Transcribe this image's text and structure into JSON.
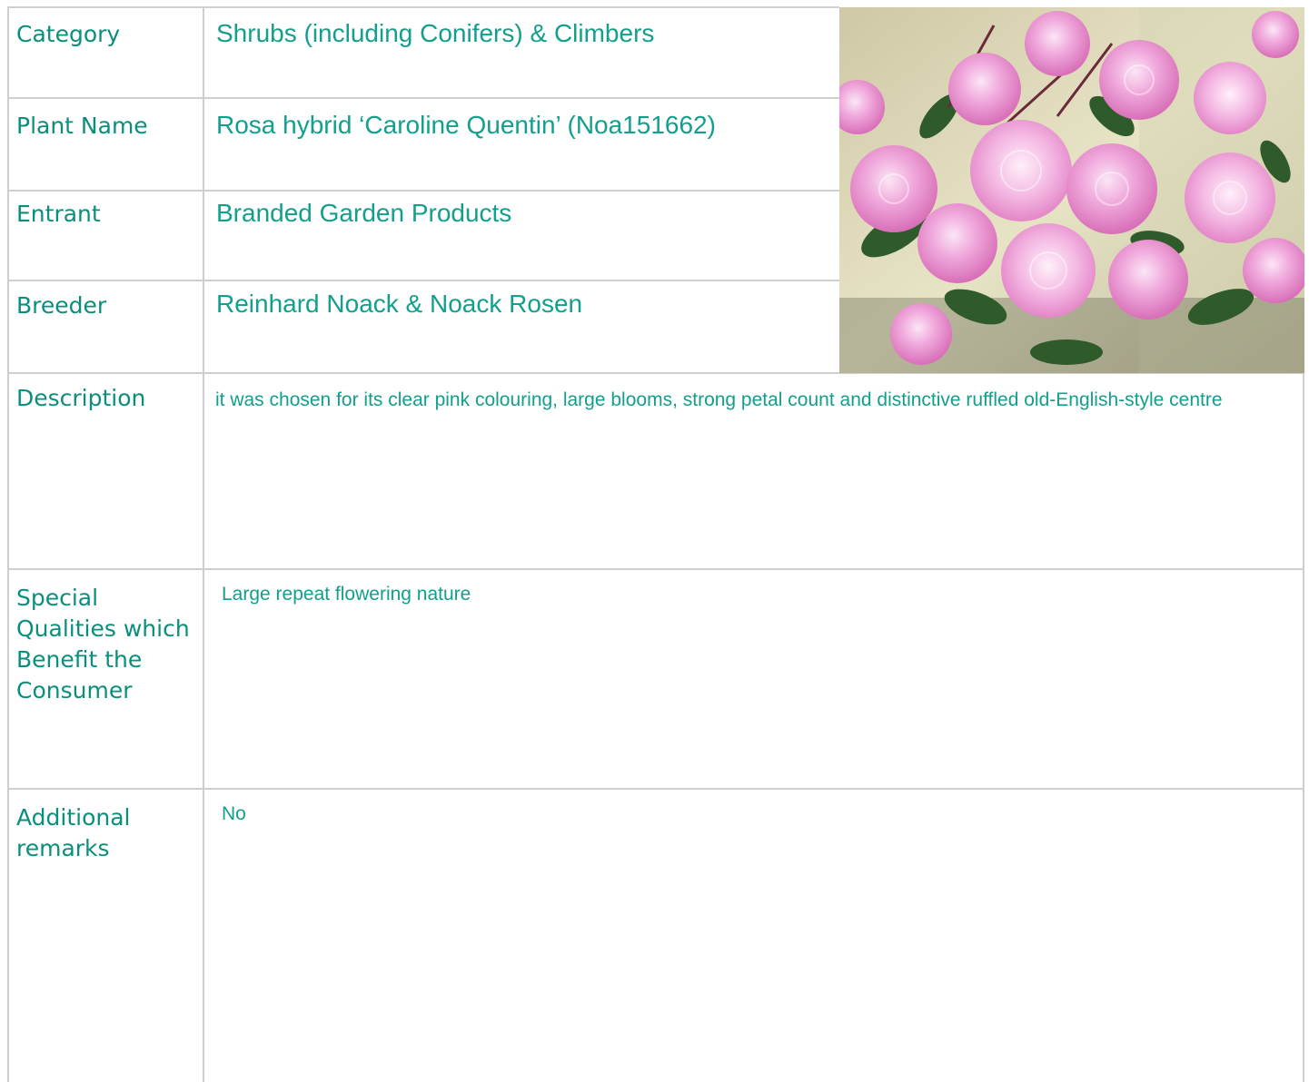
{
  "rows": [
    {
      "label": "Category",
      "value": "Shrubs (including Conifers) & Climbers"
    },
    {
      "label": "Plant Name",
      "value": "Rosa hybrid ‘Caroline Quentin’ (Noa151662)"
    },
    {
      "label": "Entrant",
      "value": "Branded Garden Products"
    },
    {
      "label": "Breeder",
      "value": "Reinhard Noack & Noack Rosen"
    },
    {
      "label": "Description",
      "value": "it was chosen for its clear pink colouring, large blooms, strong petal count and distinctive ruffled old-English-style centre"
    },
    {
      "label": "Special Qualities which Benefit the Consumer",
      "value": "Large repeat flowering nature"
    },
    {
      "label": "Additional remarks",
      "value": "No"
    }
  ],
  "colors": {
    "text": "#0a8f7c",
    "grid": "#cfcfcf"
  }
}
